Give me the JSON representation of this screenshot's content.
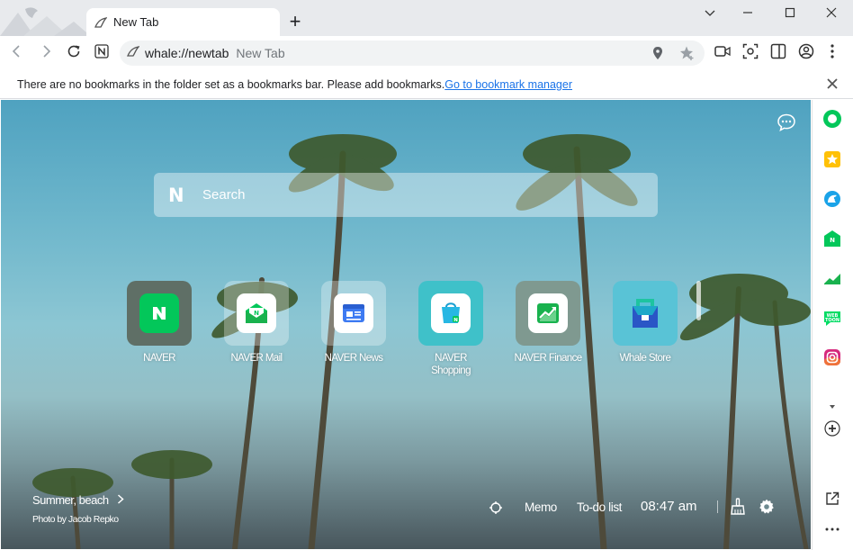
{
  "window": {
    "tab_title": "New Tab",
    "new_tab": "+",
    "controls": [
      "chevron-down-icon",
      "minimize-icon",
      "maximize-icon",
      "close-icon"
    ]
  },
  "toolbar": {
    "url": "whale://newtab",
    "page_title": "New Tab"
  },
  "bookmarks_bar": {
    "message": "There are no bookmarks in the folder set as a bookmarks bar. Please add bookmarks.",
    "link": "Go to bookmark manager"
  },
  "search": {
    "logo": "N",
    "placeholder": "Search"
  },
  "shortcuts": [
    {
      "label": "NAVER",
      "bg": "#5f6f66",
      "icon": "naver-icon"
    },
    {
      "label": "NAVER Mail",
      "bg": "rgba(255,255,255,0.3)",
      "icon": "mail-icon"
    },
    {
      "label": "NAVER News",
      "bg": "rgba(255,255,255,0.3)",
      "icon": "news-icon"
    },
    {
      "label": "NAVER\nShopping",
      "bg": "#3fc1c9",
      "icon": "shopping-icon"
    },
    {
      "label": "NAVER Finance",
      "bg": "#7f9990",
      "icon": "finance-icon"
    },
    {
      "label": "Whale Store",
      "bg": "#59c3d6",
      "icon": "store-icon"
    }
  ],
  "photo": {
    "title": "Summer, beach",
    "credit": "Photo by Jacob Repko"
  },
  "bottom_bar": {
    "memo": "Memo",
    "todo": "To-do list",
    "time": "08:47 am"
  },
  "colors": {
    "accent": "#1a73e8",
    "naver_green": "#03c75a"
  }
}
